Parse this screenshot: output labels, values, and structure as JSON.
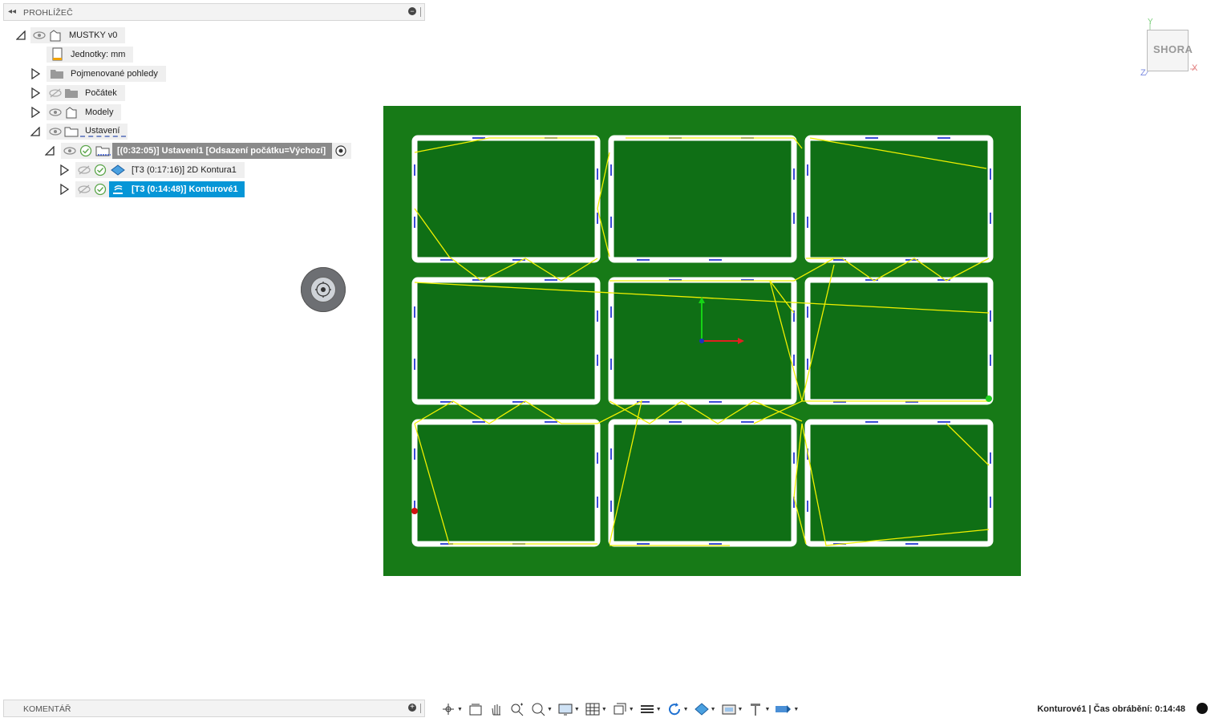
{
  "browser": {
    "title": "PROHLÍŽEČ",
    "tree": [
      {
        "label": "MUSTKY v0"
      },
      {
        "label": "Jednotky: mm"
      },
      {
        "label": "Pojmenované pohledy"
      },
      {
        "label": "Počátek"
      },
      {
        "label": "Modely"
      },
      {
        "label": "Ustavení"
      },
      {
        "label": "[(0:32:05)] Ustavení1 [Odsazení počátku=Výchozí]"
      },
      {
        "label": "[T3 (0:17:16)] 2D Kontura1"
      },
      {
        "label": "[T3 (0:14:48)] Konturové1"
      }
    ]
  },
  "comments": {
    "title": "KOMENTÁŘ"
  },
  "viewcube": {
    "face_label": "SHORA",
    "axis_x": "X",
    "axis_y": "Y",
    "axis_z": "Z"
  },
  "canvas": {
    "stock_color": "#177a17",
    "pocket_color": "#0f6f15",
    "contour_color": "#ffffff",
    "toolpath_color": "#f0f000",
    "lead_color": "#3a4bd6",
    "grid_rows": 3,
    "grid_cols": 3
  },
  "toolbar": {
    "icons": [
      "orbit-icon",
      "look-at-icon",
      "pan-icon",
      "zoom-icon",
      "zoom-window-icon",
      "display-settings-icon",
      "grid-icon",
      "view-icon",
      "layers-icon",
      "refresh-icon",
      "material-icon",
      "camera-icon",
      "tool-icon",
      "simulation-icon"
    ]
  },
  "status": {
    "text": "Konturové1 | Čas obrábění: 0:14:48"
  }
}
